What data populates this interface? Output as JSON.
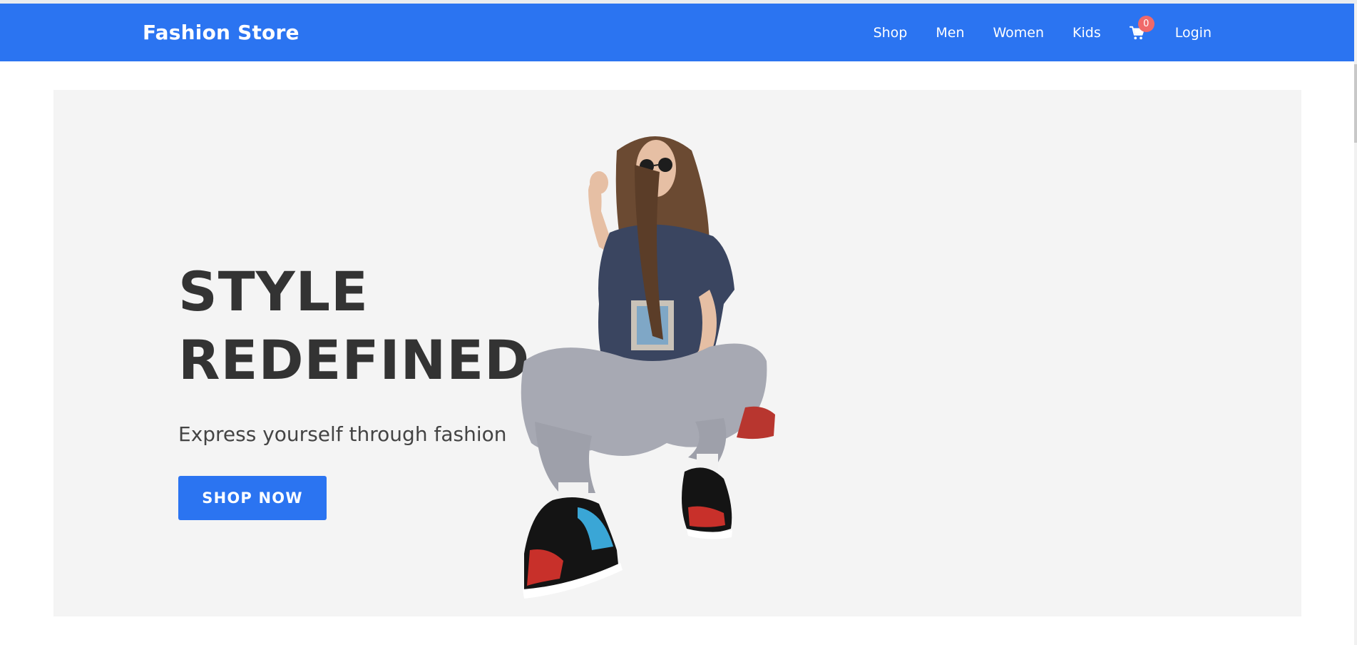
{
  "header": {
    "brand": "Fashion Store",
    "nav": [
      "Shop",
      "Men",
      "Women",
      "Kids"
    ],
    "cart_count": "0",
    "login": "Login",
    "cart_icon": "cart-icon"
  },
  "hero": {
    "title_line1": "STYLE",
    "title_line2": "REDEFINED",
    "subtitle": "Express yourself through fashion",
    "cta": "SHOP NOW",
    "image_subject": "model-photo"
  },
  "colors": {
    "primary": "#2b74f1",
    "badge": "#f0696a",
    "hero_bg": "#f4f4f4",
    "title_text": "#333333"
  }
}
